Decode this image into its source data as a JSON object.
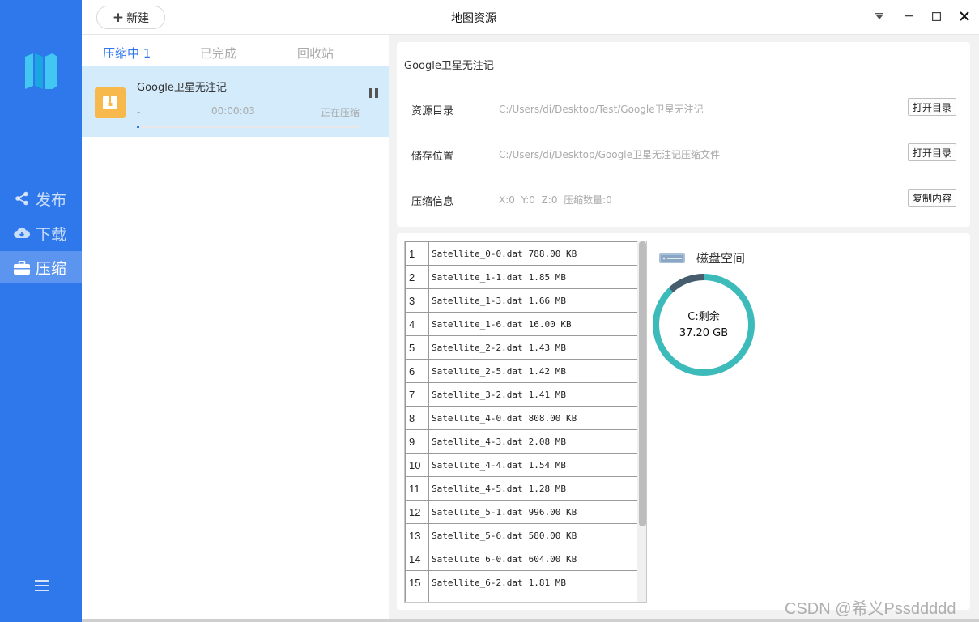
{
  "app": {
    "title": "地图资源",
    "new_button": "新建"
  },
  "sidebar": {
    "items": [
      {
        "label": "发布",
        "icon": "share-icon"
      },
      {
        "label": "下载",
        "icon": "cloud-download-icon"
      },
      {
        "label": "压缩",
        "icon": "briefcase-icon",
        "active": true
      }
    ],
    "menu_icon": "hamburger-menu-icon"
  },
  "tabs": [
    {
      "label": "压缩中 1",
      "active": true
    },
    {
      "label": "已完成"
    },
    {
      "label": "回收站"
    }
  ],
  "task": {
    "name": "Google卫星无注记",
    "dash": "-",
    "elapsed": "00:00:03",
    "status": "正在压缩",
    "progress": 0.01
  },
  "info": {
    "title": "Google卫星无注记",
    "rows": [
      {
        "label": "资源目录",
        "value": "C:/Users/di/Desktop/Test/Google卫星无注记",
        "button": "打开目录"
      },
      {
        "label": "储存位置",
        "value": "C:/Users/di/Desktop/Google卫星无注记压缩文件",
        "button": "打开目录"
      },
      {
        "label": "压缩信息",
        "value": "X:0  Y:0  Z:0  压缩数量:0",
        "button": "复制内容"
      }
    ]
  },
  "files": [
    {
      "idx": "1",
      "name": "Satellite_0-0.dat",
      "size": "788.00 KB"
    },
    {
      "idx": "2",
      "name": "Satellite_1-1.dat",
      "size": "1.85 MB"
    },
    {
      "idx": "3",
      "name": "Satellite_1-3.dat",
      "size": "1.66 MB"
    },
    {
      "idx": "4",
      "name": "Satellite_1-6.dat",
      "size": "16.00 KB"
    },
    {
      "idx": "5",
      "name": "Satellite_2-2.dat",
      "size": "1.43 MB"
    },
    {
      "idx": "6",
      "name": "Satellite_2-5.dat",
      "size": "1.42 MB"
    },
    {
      "idx": "7",
      "name": "Satellite_3-2.dat",
      "size": "1.41 MB"
    },
    {
      "idx": "8",
      "name": "Satellite_4-0.dat",
      "size": "808.00 KB"
    },
    {
      "idx": "9",
      "name": "Satellite_4-3.dat",
      "size": "2.08 MB"
    },
    {
      "idx": "10",
      "name": "Satellite_4-4.dat",
      "size": "1.54 MB"
    },
    {
      "idx": "11",
      "name": "Satellite_4-5.dat",
      "size": "1.28 MB"
    },
    {
      "idx": "12",
      "name": "Satellite_5-1.dat",
      "size": "996.00 KB"
    },
    {
      "idx": "13",
      "name": "Satellite_5-6.dat",
      "size": "580.00 KB"
    },
    {
      "idx": "14",
      "name": "Satellite_6-0.dat",
      "size": "604.00 KB"
    },
    {
      "idx": "15",
      "name": "Satellite_6-2.dat",
      "size": "1.81 MB"
    }
  ],
  "disk": {
    "title": "磁盘空间",
    "drive_label": "C:剩余",
    "free_text": "37.20 GB",
    "used_fraction": 0.12,
    "free_color": "#3dbbbb",
    "used_color": "#475d6e"
  },
  "watermark": "CSDN @希义Pssddddd",
  "colors": {
    "sidebar": "#2f78ec",
    "accent": "#2f78ec",
    "task_highlight": "#d3ebfb",
    "task_icon": "#f7b84c"
  }
}
